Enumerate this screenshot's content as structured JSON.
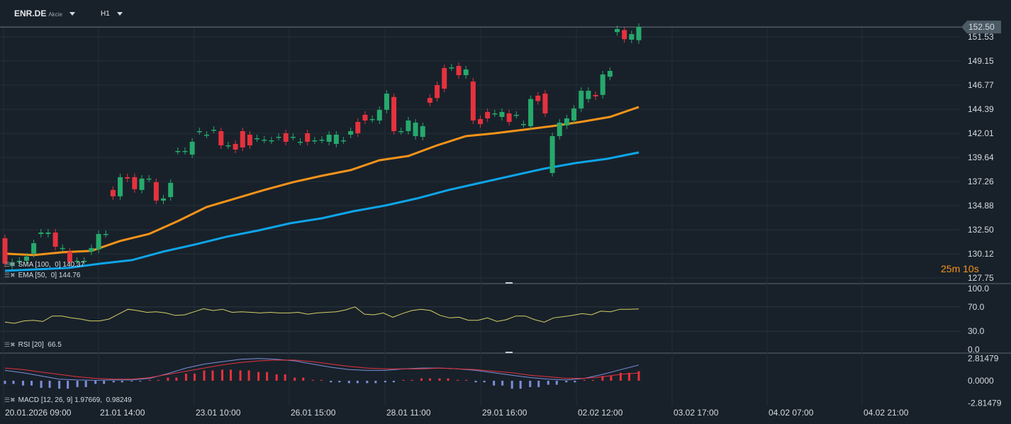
{
  "header": {
    "symbol": "ENR.DE",
    "type": "Akcie",
    "timeframe": "H1"
  },
  "price_axis": {
    "labels": [
      "151.53",
      "149.15",
      "146.77",
      "144.39",
      "142.01",
      "139.64",
      "137.26",
      "134.88",
      "132.50",
      "130.12",
      "127.75"
    ],
    "current_price": "152.50"
  },
  "timer": "25m 10s",
  "legend": {
    "sma": "SMA [100,  0] 140.37",
    "ema": "EMA [50,  0] 144.76",
    "rsi": "RSI [20]  66.5",
    "macd": "MACD [12, 26, 9] 1.97669,  0.98249"
  },
  "rsi_axis": [
    "100.0",
    "70.0",
    "30.0",
    "0.0"
  ],
  "macd_axis": [
    "2.81479",
    "0.0000",
    "-2.81479"
  ],
  "time_axis": [
    "20.01.2026 09:00",
    "21.01 14:00",
    "23.01 10:00",
    "26.01 15:00",
    "28.01 11:00",
    "29.01 16:00",
    "02.02 12:00",
    "03.02 17:00",
    "04.02 07:00",
    "04.02 21:00"
  ],
  "colors": {
    "up": "#26a96c",
    "down": "#e5323e",
    "ema": "#f7931a",
    "sma": "#0ea5e9",
    "rsi": "#d4d064",
    "macd": "#7b8fd9",
    "signal": "#e5323e"
  },
  "chart_data": {
    "type": "candlestick",
    "candles": [
      [
        131.67,
        129.16
      ],
      [
        128.95,
        129.3
      ],
      [
        129.3,
        129.44
      ],
      [
        129.44,
        129.86
      ],
      [
        130.14,
        131.18
      ],
      [
        132.09,
        132.23
      ],
      [
        132.09,
        132.23
      ],
      [
        132.23,
        130.83
      ],
      [
        130.7,
        130.7
      ],
      [
        130.35,
        129.3
      ],
      [
        129.44,
        129.44
      ],
      [
        129.44,
        129.44
      ],
      [
        130.35,
        130.7
      ],
      [
        130.56,
        132.09
      ],
      [
        132.09,
        132.09
      ],
      [
        136.43,
        135.8
      ],
      [
        135.8,
        137.69
      ],
      [
        137.69,
        137.55
      ],
      [
        137.69,
        136.5
      ],
      [
        136.43,
        137.55
      ],
      [
        137.55,
        137.55
      ],
      [
        137.2,
        135.38
      ],
      [
        135.38,
        135.59
      ],
      [
        135.73,
        137.13
      ],
      [
        140.27,
        140.27
      ],
      [
        140.27,
        140.27
      ],
      [
        139.92,
        141.18
      ],
      [
        142.23,
        142.23
      ],
      [
        141.88,
        141.88
      ],
      [
        142.37,
        142.37
      ],
      [
        142.23,
        140.83
      ],
      [
        140.83,
        140.83
      ],
      [
        140.97,
        140.41
      ],
      [
        142.23,
        140.62
      ],
      [
        141.88,
        140.83
      ],
      [
        141.53,
        141.53
      ],
      [
        141.39,
        141.39
      ],
      [
        141.32,
        141.32
      ],
      [
        141.67,
        141.67
      ],
      [
        142.02,
        141.18
      ],
      [
        141.67,
        141.67
      ],
      [
        141.18,
        141.18
      ],
      [
        142.02,
        141.18
      ],
      [
        141.32,
        141.32
      ],
      [
        141.39,
        141.39
      ],
      [
        141.18,
        141.88
      ],
      [
        140.97,
        141.88
      ],
      [
        141.32,
        141.32
      ],
      [
        141.88,
        142.23
      ],
      [
        143.14,
        142.02
      ],
      [
        143.84,
        143.28
      ],
      [
        143.42,
        143.42
      ],
      [
        143.28,
        144.33
      ],
      [
        144.33,
        145.93
      ],
      [
        145.6,
        142.23
      ],
      [
        142.23,
        142.23
      ],
      [
        142.23,
        143.28
      ],
      [
        141.74,
        143.07
      ],
      [
        141.67,
        142.72
      ],
      [
        145.5,
        145.03
      ],
      [
        146.77,
        145.5
      ],
      [
        148.45,
        146.42
      ],
      [
        148.52,
        148.52
      ],
      [
        148.66,
        147.75
      ],
      [
        147.75,
        148.31
      ],
      [
        147.12,
        143.28
      ],
      [
        143.42,
        142.93
      ],
      [
        144.12,
        143.49
      ],
      [
        143.98,
        143.98
      ],
      [
        143.63,
        144.12
      ],
      [
        143.98,
        143.14
      ],
      [
        143.84,
        143.84
      ],
      [
        142.93,
        142.93
      ],
      [
        142.72,
        145.4
      ],
      [
        145.73,
        145.2
      ],
      [
        145.93,
        143.98
      ],
      [
        138.1,
        141.74
      ],
      [
        141.74,
        143.07
      ],
      [
        142.79,
        143.49
      ],
      [
        143.28,
        144.47
      ],
      [
        144.47,
        146.21
      ],
      [
        145.4,
        146.21
      ],
      [
        145.8,
        145.66
      ],
      [
        145.8,
        147.82
      ],
      [
        147.6,
        148.17
      ],
      [
        152.0,
        152.3
      ],
      [
        152.2,
        151.3
      ],
      [
        151.25,
        151.8
      ],
      [
        151.2,
        152.51
      ]
    ],
    "ema": [
      130.14,
      130.0,
      130.28,
      130.42,
      131.4,
      132.09,
      133.35,
      134.75,
      135.59,
      136.43,
      137.2,
      137.83,
      138.39,
      139.36,
      139.78,
      140.83,
      141.74,
      142.02,
      142.37,
      142.72,
      143.14,
      143.63,
      144.61
    ],
    "sma": [
      128.46,
      128.6,
      128.74,
      129.16,
      129.51,
      130.35,
      131.05,
      131.82,
      132.44,
      133.14,
      133.63,
      134.33,
      134.89,
      135.59,
      136.43,
      137.13,
      137.83,
      138.52,
      139.08,
      139.5,
      140.13
    ],
    "rsi": [
      45,
      43,
      47,
      48,
      46,
      55,
      55,
      52,
      50,
      47,
      47,
      50,
      58,
      66,
      64,
      61,
      62,
      60,
      56,
      57,
      62,
      67,
      64,
      66,
      61,
      62,
      61,
      60,
      61,
      60,
      60,
      61,
      58,
      60,
      61,
      62,
      65,
      70,
      58,
      57,
      60,
      53,
      59,
      64,
      66,
      64,
      56,
      52,
      53,
      48,
      48,
      52,
      46,
      49,
      55,
      55,
      49,
      45,
      52,
      54,
      56,
      59,
      57,
      63,
      62,
      66,
      66,
      66.5
    ],
    "macd": [
      1.3,
      1.0,
      0.6,
      0.2,
      0.1,
      0.05,
      0.1,
      0.1,
      0.3,
      0.9,
      1.6,
      2.1,
      2.4,
      2.7,
      2.8,
      2.7,
      2.5,
      2.1,
      1.7,
      1.4,
      1.3,
      1.3,
      1.5,
      1.6,
      1.6,
      1.5,
      1.3,
      1.0,
      0.7,
      0.4,
      0.2,
      0.1,
      0.3,
      0.8,
      1.4,
      1.98
    ],
    "signal": [
      1.6,
      1.4,
      1.1,
      0.8,
      0.5,
      0.3,
      0.2,
      0.2,
      0.4,
      0.8,
      1.2,
      1.6,
      2.0,
      2.3,
      2.5,
      2.6,
      2.6,
      2.4,
      2.1,
      1.8,
      1.6,
      1.5,
      1.5,
      1.5,
      1.6,
      1.5,
      1.4,
      1.2,
      1.0,
      0.7,
      0.5,
      0.3,
      0.3,
      0.5,
      0.8,
      0.98
    ],
    "hist": [
      -0.4,
      -0.6,
      -0.9,
      -1.0,
      -0.8,
      -0.4,
      -0.2,
      -0.1,
      0.1,
      0.4,
      0.9,
      1.3,
      1.4,
      1.3,
      1.1,
      0.8,
      0.4,
      0.1,
      -0.2,
      -0.3,
      -0.3,
      -0.2,
      0.1,
      0.3,
      0.3,
      0.1,
      -0.2,
      -0.6,
      -1.0,
      -0.8,
      -0.5,
      -0.2,
      0.1,
      0.6,
      1.0,
      1.2
    ],
    "price_range": [
      127.75,
      152.5
    ],
    "rsi_range": [
      0,
      100
    ],
    "macd_range": [
      -2.81479,
      2.81479
    ]
  }
}
